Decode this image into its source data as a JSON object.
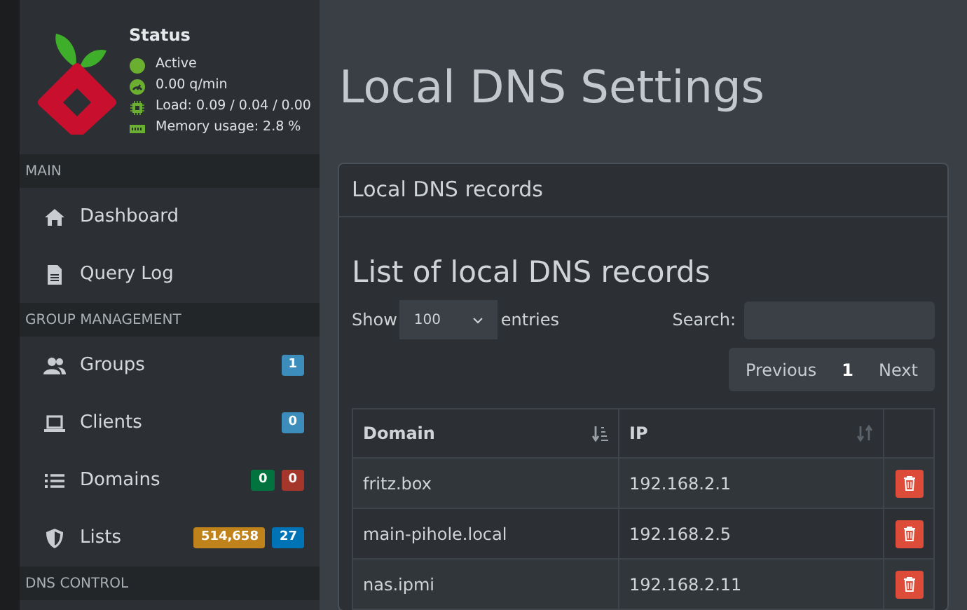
{
  "status": {
    "title": "Status",
    "lines": [
      {
        "kind": "dot",
        "text": "Active"
      },
      {
        "kind": "gauge",
        "text": "0.00 q/min"
      },
      {
        "kind": "chip",
        "text": "Load: 0.09 / 0.04 / 0.00"
      },
      {
        "kind": "memory",
        "text": "Memory usage: 2.8 %"
      }
    ]
  },
  "sidebar": [
    {
      "header": "MAIN",
      "items": [
        {
          "kind": "home",
          "label": "Dashboard"
        },
        {
          "kind": "file",
          "label": "Query Log"
        }
      ]
    },
    {
      "header": "GROUP MANAGEMENT",
      "items": [
        {
          "kind": "users",
          "label": "Groups",
          "badges": [
            {
              "text": "1",
              "color": "#3c8dbc"
            }
          ]
        },
        {
          "kind": "laptop",
          "label": "Clients",
          "badges": [
            {
              "text": "0",
              "color": "#3c8dbc"
            }
          ]
        },
        {
          "kind": "list",
          "label": "Domains",
          "badges": [
            {
              "text": "0",
              "color": "#00733e"
            },
            {
              "text": "0",
              "color": "#a5362b"
            }
          ]
        },
        {
          "kind": "shield",
          "label": "Lists",
          "badges": [
            {
              "text": "514,658",
              "color": "#c0831b"
            },
            {
              "text": "27",
              "color": "#0073b7"
            }
          ]
        }
      ]
    },
    {
      "header": "DNS CONTROL"
    }
  ],
  "page_title": "Local DNS Settings",
  "box": {
    "title": "Local DNS records",
    "list_title": "List of local DNS records",
    "length": {
      "before": "Show",
      "value": "100",
      "after": "entries"
    },
    "search": {
      "label": "Search:"
    },
    "pagination": [
      {
        "label": "Previous",
        "selected": false
      },
      {
        "label": "1",
        "selected": true
      },
      {
        "label": "Next",
        "selected": false
      }
    ],
    "table": {
      "columns": [
        {
          "label": "Domain",
          "selected": true
        },
        {
          "label": "IP",
          "selected": false
        }
      ],
      "rows": [
        [
          "fritz.box",
          "192.168.2.1"
        ],
        [
          "main-pihole.local",
          "192.168.2.5"
        ],
        [
          "nas.ipmi",
          "192.168.2.11"
        ]
      ]
    }
  }
}
